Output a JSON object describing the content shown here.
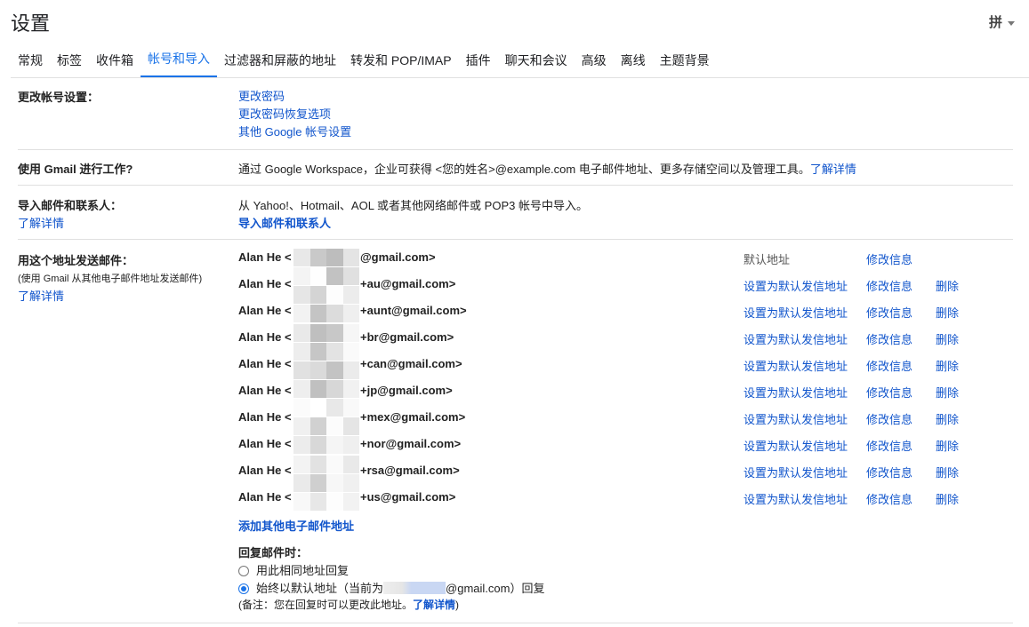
{
  "header": {
    "title": "设置",
    "ime": "拼"
  },
  "tabs": [
    {
      "label": "常规"
    },
    {
      "label": "标签"
    },
    {
      "label": "收件箱"
    },
    {
      "label": "帐号和导入"
    },
    {
      "label": "过滤器和屏蔽的地址"
    },
    {
      "label": "转发和 POP/IMAP"
    },
    {
      "label": "插件"
    },
    {
      "label": "聊天和会议"
    },
    {
      "label": "高级"
    },
    {
      "label": "离线"
    },
    {
      "label": "主题背景"
    }
  ],
  "active_tab": "帐号和导入",
  "change_account": {
    "label": "更改帐号设置：",
    "links": [
      "更改密码",
      "更改密码恢复选项",
      "其他 Google 帐号设置"
    ]
  },
  "gmail_work": {
    "label": "使用 Gmail 进行工作?",
    "text": "通过 Google Workspace，企业可获得 <您的姓名>@example.com 电子邮件地址、更多存储空间以及管理工具。",
    "link": "了解详情"
  },
  "import": {
    "label": "导入邮件和联系人：",
    "learn_more": "了解详情",
    "text": "从 Yahoo!、Hotmail、AOL 或者其他网络邮件或 POP3 帐号中导入。",
    "link": "导入邮件和联系人"
  },
  "send_as": {
    "label": "用这个地址发送邮件：",
    "sublabel": "(使用 Gmail 从其他电子邮件地址发送邮件)",
    "learn_more": "了解详情",
    "name_prefix": "Alan He <",
    "default_text": "默认地址",
    "set_default": "设置为默认发信地址",
    "edit": "修改信息",
    "delete": "删除",
    "addresses": [
      {
        "suffix": "@gmail.com>",
        "is_default": true
      },
      {
        "suffix": "+au@gmail.com>",
        "is_default": false
      },
      {
        "suffix": "+aunt@gmail.com>",
        "is_default": false
      },
      {
        "suffix": "+br@gmail.com>",
        "is_default": false
      },
      {
        "suffix": "+can@gmail.com>",
        "is_default": false
      },
      {
        "suffix": "+jp@gmail.com>",
        "is_default": false
      },
      {
        "suffix": "+mex@gmail.com>",
        "is_default": false
      },
      {
        "suffix": "+nor@gmail.com>",
        "is_default": false
      },
      {
        "suffix": "+rsa@gmail.com>",
        "is_default": false
      },
      {
        "suffix": "+us@gmail.com>",
        "is_default": false
      }
    ],
    "add_link": "添加其他电子邮件地址",
    "reply_heading": "回复邮件时：",
    "reply_same": "用此相同地址回复",
    "reply_default_prefix": "始终以默认地址（当前为",
    "reply_default_suffix": "@gmail.com）回复",
    "note_prefix": "(备注：您在回复时可以更改此地址。",
    "note_link": "了解详情",
    "note_suffix": ")",
    "reply_selected": "default"
  },
  "colors": {
    "accent": "#1a73e8",
    "link": "#1155cc",
    "divider": "#e0e0e0"
  }
}
